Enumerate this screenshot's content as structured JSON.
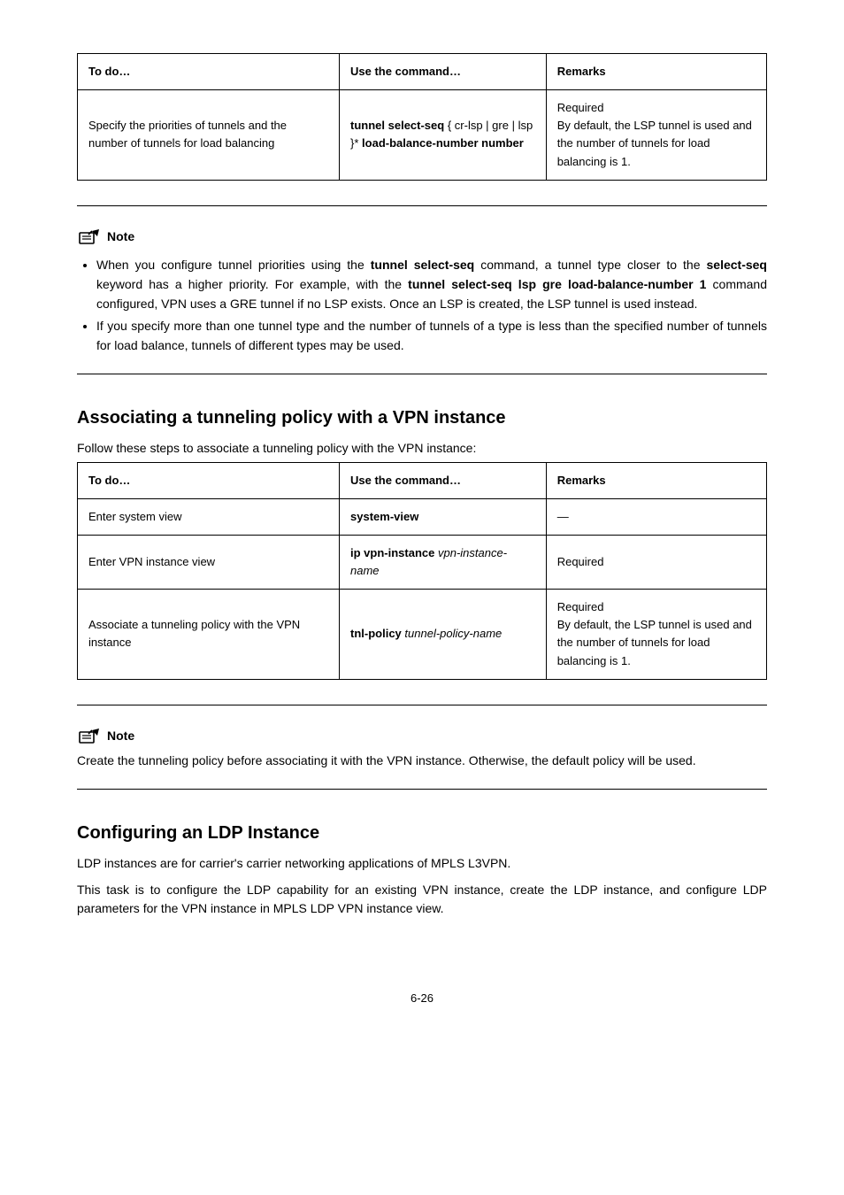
{
  "table1": {
    "headers": [
      "To do…",
      "Use the command…",
      "Remarks"
    ],
    "row": {
      "todo": "Specify the priorities of tunnels and the number of tunnels for load balancing",
      "cmd_prefix": "tunnel select-seq",
      "cmd_opts": "{ cr-lsp | gre | lsp }*",
      "cmd_suffix": "load-balance-number number",
      "remarks_line1": "Required",
      "remarks_line2": "By default, the LSP tunnel is used and the number of tunnels for load balancing is 1."
    }
  },
  "note1": {
    "label": "Note",
    "bullet1_a": "When you configure tunnel priorities using the ",
    "bullet1_b": "tunnel select-seq",
    "bullet1_c": " command, a tunnel type closer to the ",
    "bullet1_d": "select-seq",
    "bullet1_e": " keyword has a higher priority. For example, with the ",
    "bullet1_f": "tunnel select-seq lsp gre load-balance-number 1",
    "bullet1_g": " command configured, VPN uses a GRE tunnel if no LSP exists. Once an LSP is created, the LSP tunnel is used instead.",
    "bullet2": "If you specify more than one tunnel type and the number of tunnels of a type is less than the specified number of tunnels for load balance, tunnels of different types may be used."
  },
  "assoc": {
    "heading": "Associating a tunneling policy with a VPN instance",
    "intro": "Follow these steps to associate a tunneling policy with the VPN instance:",
    "headers": [
      "To do…",
      "Use the command…",
      "Remarks"
    ],
    "rows": [
      {
        "todo": "Enter system view",
        "cmd": "system-view",
        "remarks": "—"
      },
      {
        "todo": "Enter VPN instance view",
        "cmd_prefix": "ip vpn-instance",
        "cmd_arg": "vpn-instance-name",
        "remarks": "Required"
      },
      {
        "todo": "Associate a tunneling policy with the VPN instance",
        "cmd_prefix": "tnl-policy",
        "cmd_arg": "tunnel-policy-name",
        "remarks_line1": "Required",
        "remarks_line2": "By default, the LSP tunnel is used and the number of tunnels for load balancing is 1."
      }
    ]
  },
  "note2": {
    "label": "Note",
    "text": "Create the tunneling policy before associating it with the VPN instance. Otherwise, the default policy will be used."
  },
  "ldp": {
    "heading": "Configuring an LDP Instance",
    "p1": "LDP instances are for carrier's carrier networking applications of MPLS L3VPN.",
    "p2": "This task is to configure the LDP capability for an existing VPN instance, create the LDP instance, and configure LDP parameters for the VPN instance in MPLS LDP VPN instance view."
  },
  "footer": "6-26"
}
